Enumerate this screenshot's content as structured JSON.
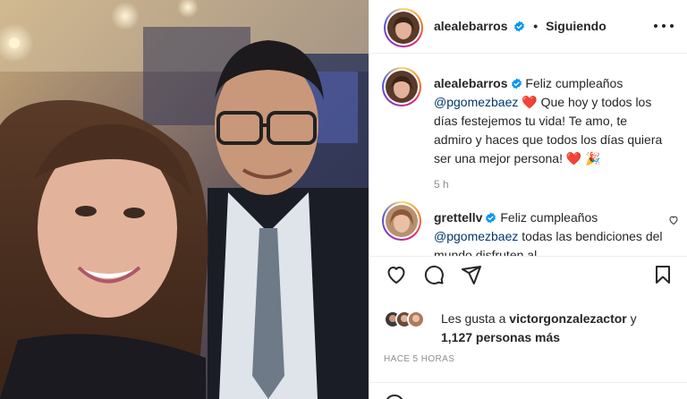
{
  "post": {
    "author": "alealebarros",
    "separator": "•",
    "follow_status": "Siguiendo",
    "more_icon": "more-options-icon"
  },
  "comments": [
    {
      "username": "alealebarros",
      "text_before_mention": " Feliz cumpleaños ",
      "mention": "@pgomezbaez",
      "text_after_mention": " Que hoy y todos los días festejemos tu vida! Te amo, te admiro y haces que todos los días quiera ser una mejor persona! ",
      "emoji_1": "❤️",
      "emoji_2": "🎉",
      "time": "5 h"
    },
    {
      "username": "grettellv",
      "text_before_mention": " Feliz cumpleaños ",
      "mention": "@pgomezbaez",
      "text_after_mention": " todas las bendiciones del mundo disfruten al"
    }
  ],
  "likes": {
    "prefix": "Les gusta a ",
    "top_liker": "victorgonzalezactor",
    "conjunction": " y",
    "count_text": "1,127 personas más"
  },
  "posted_time": "HACE 5 HORAS",
  "colors": {
    "accent_blue": "#0095f6",
    "heart_red": "#ed4956",
    "text": "#262626",
    "muted": "#8e8e8e",
    "mention": "#00376b"
  }
}
